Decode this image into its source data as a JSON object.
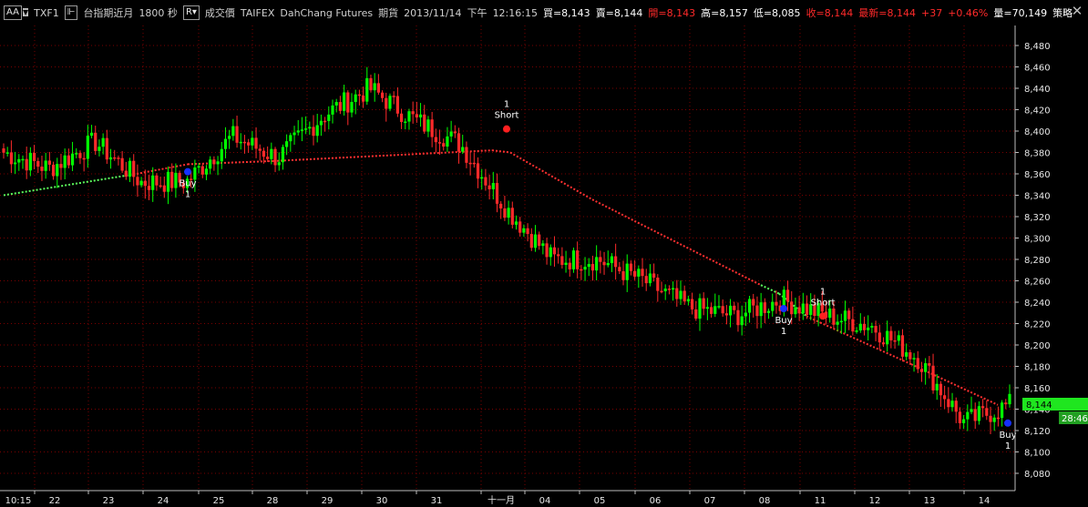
{
  "toolbar": {
    "layout_button": "AA",
    "symbol": "TXF1",
    "product_name": "台指期近月",
    "interval": "1800 秒",
    "price_type": "成交價",
    "exchange": "TAIFEX",
    "broker": "DahChang Futures",
    "market": "期貨",
    "date": "2013/11/14",
    "session": "下午",
    "time": "12:16:15",
    "bid": "買=8,143",
    "ask": "賣=8,144",
    "open": "開=8,143",
    "high": "高=8,157",
    "low": "低=8,085",
    "close": "收=8,144",
    "last": "最新=8,144",
    "change": "+37",
    "change_pct": "+0.46%",
    "volume": "量=70,149",
    "strategy_menu": "策略"
  },
  "colors": {
    "background": "#000000",
    "up": "#00ff00",
    "down": "#ff2a2a",
    "grid": "#7a0000",
    "trail_long": "#5cff5c",
    "trail_short": "#ff3030",
    "price_tag": "#1fe61f",
    "time_tag": "#22a022"
  },
  "price_tag": "8,144",
  "time_tag": "28:46",
  "chart_data": {
    "type": "candlestick",
    "ylim": [
      8072,
      8492
    ],
    "yticks": [
      "8,480",
      "8,460",
      "8,440",
      "8,420",
      "8,400",
      "8,380",
      "8,360",
      "8,340",
      "8,320",
      "8,300",
      "8,280",
      "8,260",
      "8,240",
      "8,220",
      "8,200",
      "8,180",
      "8,160",
      "8,140",
      "8,120",
      "8,100",
      "8,080"
    ],
    "date_labels": [
      "10:15",
      "22",
      "23",
      "24",
      "25",
      "28",
      "29",
      "30",
      "31",
      "十一月",
      "04",
      "05",
      "06",
      "07",
      "08",
      "11",
      "12",
      "13",
      "14"
    ],
    "ohlc_anchors": [
      [
        8410,
        8350
      ],
      [
        8400,
        8330
      ],
      [
        8420,
        8360
      ],
      [
        8405,
        8300
      ],
      [
        8360,
        8345
      ],
      [
        8410,
        8380
      ],
      [
        8395,
        8355
      ],
      [
        8445,
        8385
      ],
      [
        8455,
        8425
      ],
      [
        8380,
        8440
      ],
      [
        8395,
        8380
      ],
      [
        8340,
        8315
      ],
      [
        8290,
        8270
      ],
      [
        8290,
        8270
      ],
      [
        8275,
        8245
      ],
      [
        8255,
        8215
      ],
      [
        8235,
        8220
      ],
      [
        8255,
        8230
      ],
      [
        8240,
        8215
      ],
      [
        8240,
        8195
      ],
      [
        8200,
        8175
      ],
      [
        8130,
        8125
      ],
      [
        8144,
        8144
      ]
    ],
    "signals": [
      {
        "label_top": "",
        "label_main": "Buy",
        "label_bottom": "1",
        "price": 8362,
        "kind": "buy"
      },
      {
        "label_top": "1",
        "label_main": "Short",
        "label_bottom": "",
        "price": 8402,
        "kind": "short"
      },
      {
        "label_top": "",
        "label_main": "Buy",
        "label_bottom": "1",
        "price": 8234,
        "kind": "buy"
      },
      {
        "label_top": "1",
        "label_main": "Short",
        "label_bottom": "",
        "price": 8227,
        "kind": "short"
      },
      {
        "label_top": "",
        "label_main": "Buy",
        "label_bottom": "1",
        "price": 8127,
        "kind": "buy"
      }
    ]
  }
}
